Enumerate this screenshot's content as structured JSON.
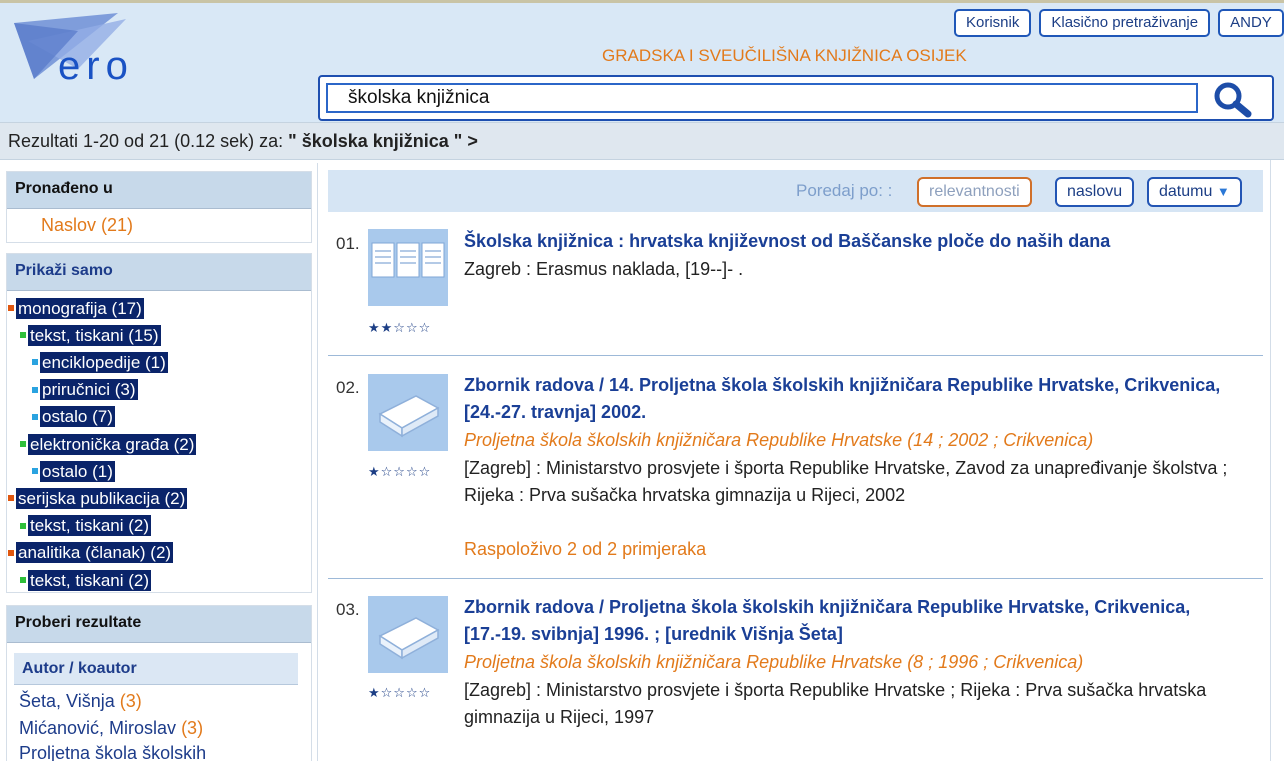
{
  "header": {
    "logo_text": "ero",
    "library_name": "GRADSKA I SVEUČILIŠNA KNJIŽNICA OSIJEK",
    "buttons": [
      "Korisnik",
      "Klasično pretraživanje",
      "ANDY"
    ],
    "search_value": "školska knjižnica"
  },
  "results": {
    "summary": "Rezultati 1-20 od 21 (0.12 sek) za:",
    "query": "\" školska knjižnica \" >"
  },
  "sidebar": {
    "found_in_title": "Pronađeno u",
    "found_in_item": "Naslov (21)",
    "show_only_title": "Prikaži samo",
    "facets": [
      {
        "label": "monografija (17)",
        "level": 0,
        "color": "#e0570f"
      },
      {
        "label": "tekst, tiskani (15)",
        "level": 1,
        "color": "#2fbf3a"
      },
      {
        "label": "enciklopedije (1)",
        "level": 2,
        "color": "#2aa3e0"
      },
      {
        "label": "priručnici (3)",
        "level": 2,
        "color": "#2aa3e0"
      },
      {
        "label": "ostalo (7)",
        "level": 2,
        "color": "#2aa3e0"
      },
      {
        "label": "elektronička građa (2)",
        "level": 1,
        "color": "#2fbf3a"
      },
      {
        "label": "ostalo (1)",
        "level": 2,
        "color": "#2aa3e0"
      },
      {
        "label": "serijska publikacija (2)",
        "level": 0,
        "color": "#e0570f"
      },
      {
        "label": "tekst, tiskani (2)",
        "level": 1,
        "color": "#2fbf3a"
      },
      {
        "label": "analitika (članak) (2)",
        "level": 0,
        "color": "#e0570f"
      },
      {
        "label": "tekst, tiskani (2)",
        "level": 1,
        "color": "#2fbf3a"
      }
    ],
    "refine_title": "Proberi rezultate",
    "author_title": "Autor / koautor",
    "authors": [
      {
        "name": "Šeta, Višnja",
        "count": "(3)"
      },
      {
        "name": "Mićanović, Miroslav",
        "count": "(3)"
      },
      {
        "name": "Proljetna škola školskih",
        "count": ""
      }
    ]
  },
  "sort": {
    "label": "Poredaj po: :",
    "options": [
      "relevantnosti",
      "naslovu",
      "datumu"
    ],
    "arrow": "▼"
  },
  "records": [
    {
      "num": "01.",
      "stars": "★★☆☆☆",
      "rating": 2,
      "icon": "book-pages-icon",
      "title": "Školska knjižnica : hrvatska književnost od Baščanske ploče do naših dana",
      "series": "",
      "publisher": "Zagreb : Erasmus naklada, [19--]- .",
      "availability": ""
    },
    {
      "num": "02.",
      "stars": "★☆☆☆☆",
      "rating": 1,
      "icon": "book-icon",
      "title": "Zbornik radova / 14. Proljetna škola školskih knjižničara Republike Hrvatske, Crikvenica, [24.-27. travnja] 2002.",
      "series": "Proljetna škola školskih knjižničara Republike Hrvatske (14 ; 2002 ; Crikvenica)",
      "publisher": "[Zagreb] : Ministarstvo prosvjete i športa Republike Hrvatske, Zavod za unapređivanje školstva ; Rijeka : Prva sušačka hrvatska gimnazija u Rijeci, 2002",
      "availability": "Raspoloživo 2 od 2 primjeraka"
    },
    {
      "num": "03.",
      "stars": "★☆☆☆☆",
      "rating": 1,
      "icon": "book-icon",
      "title": "Zbornik radova / Proljetna škola školskih knjižničara Republike Hrvatske, Crikvenica, [17.-19. svibnja] 1996. ; [urednik Višnja Šeta]",
      "series": "Proljetna škola školskih knjižničara Republike Hrvatske (8 ; 1996 ; Crikvenica)",
      "publisher": "[Zagreb] : Ministarstvo prosvjete i športa Republike Hrvatske ; Rijeka : Prva sušačka hrvatska gimnazija u Rijeci, 1997",
      "availability": ""
    }
  ]
}
